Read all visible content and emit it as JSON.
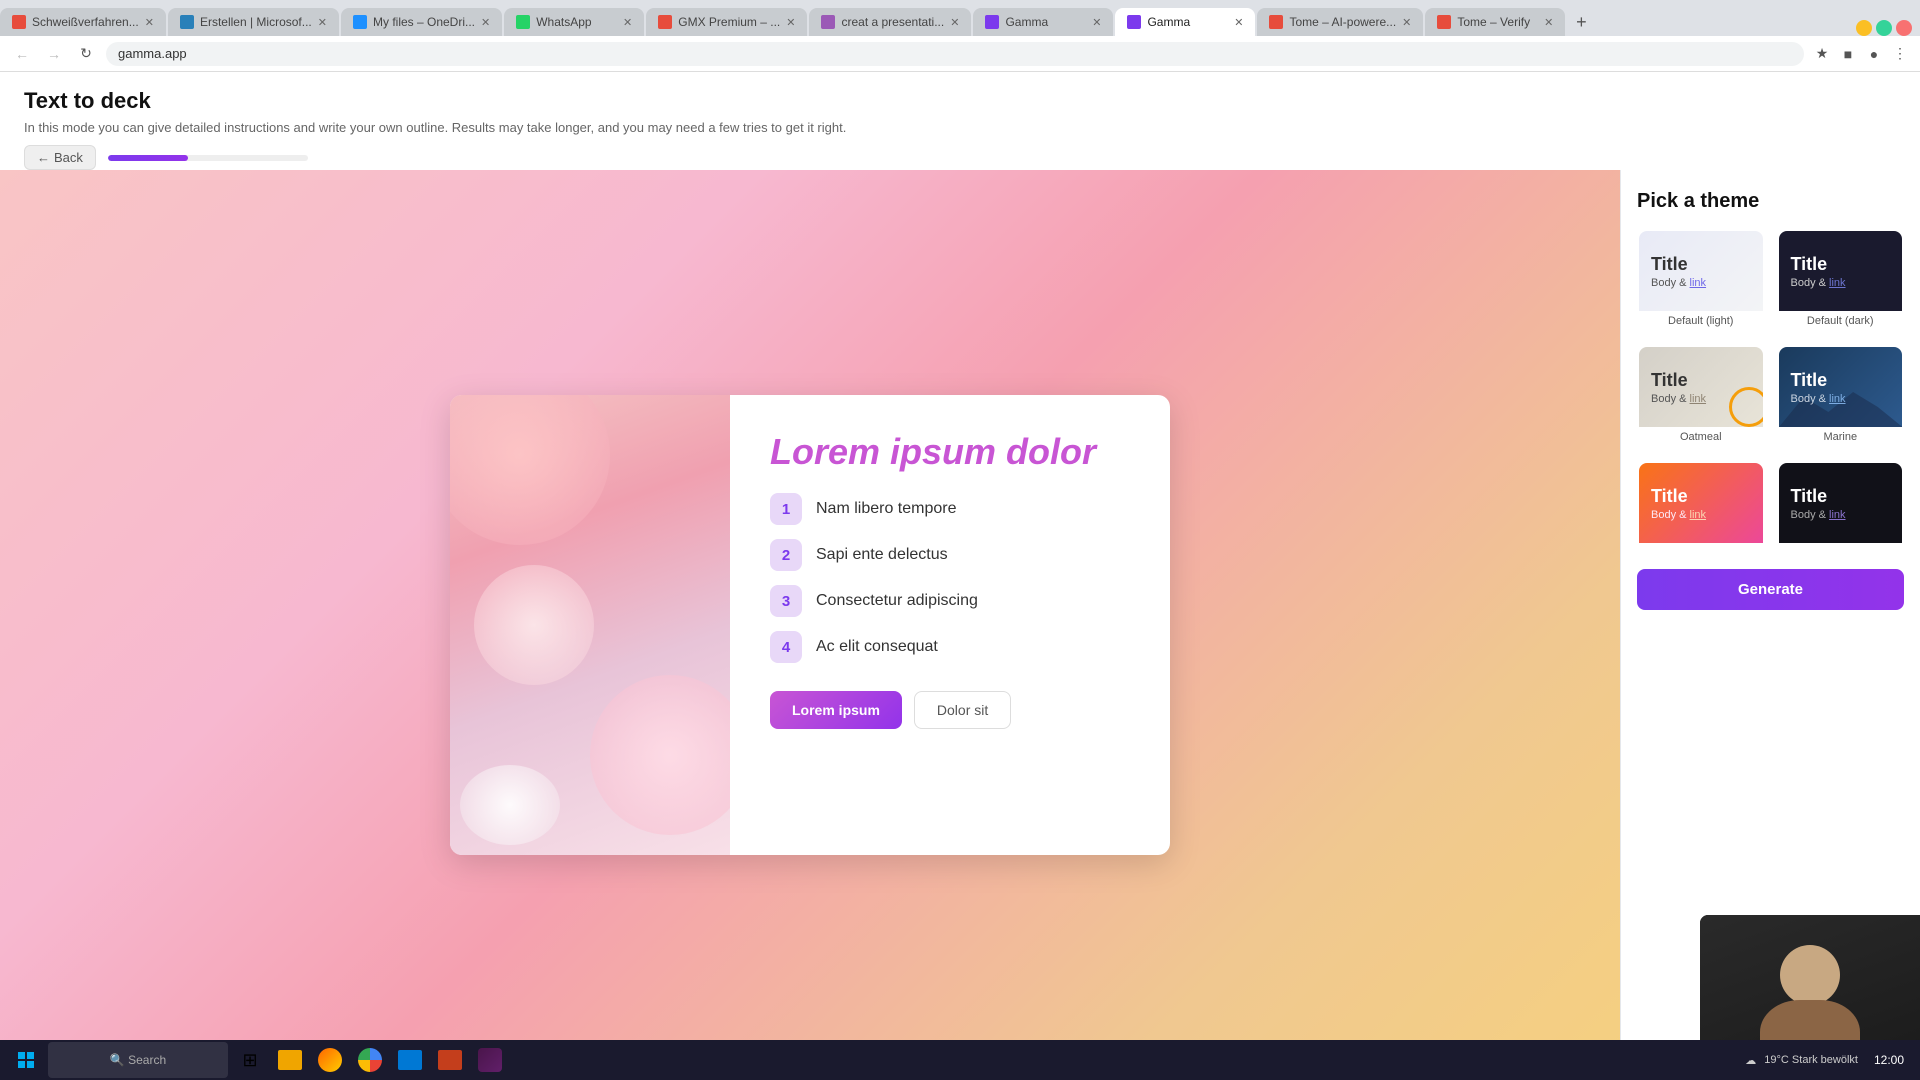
{
  "browser": {
    "tabs": [
      {
        "id": "tab1",
        "label": "Schweißverfahren...",
        "favicon_color": "#e74c3c",
        "active": false
      },
      {
        "id": "tab2",
        "label": "Erstellen | Microsof...",
        "favicon_color": "#2980b9",
        "active": false
      },
      {
        "id": "tab3",
        "label": "My files – OneDri...",
        "favicon_color": "#1e90ff",
        "active": false
      },
      {
        "id": "tab4",
        "label": "WhatsApp",
        "favicon_color": "#25d366",
        "active": false
      },
      {
        "id": "tab5",
        "label": "GMX Premium – ...",
        "favicon_color": "#e74c3c",
        "active": false
      },
      {
        "id": "tab6",
        "label": "creat a presentati...",
        "favicon_color": "#9b59b6",
        "active": false
      },
      {
        "id": "tab7",
        "label": "Gamma",
        "favicon_color": "#7c3aed",
        "active": false
      },
      {
        "id": "tab8",
        "label": "Gamma",
        "favicon_color": "#7c3aed",
        "active": true
      },
      {
        "id": "tab9",
        "label": "Tome – AI-powere...",
        "favicon_color": "#e74c3c",
        "active": false
      },
      {
        "id": "tab10",
        "label": "Tome – Verify",
        "favicon_color": "#e74c3c",
        "active": false
      }
    ],
    "address": "gamma.app"
  },
  "page": {
    "title": "Text to deck",
    "subtitle": "In this mode you can give detailed instructions and write your own outline. Results may take longer, and you may need a few tries to get it right.",
    "back_label": "Back",
    "progress_percent": 40
  },
  "slide": {
    "title": "Lorem ipsum dolor",
    "items": [
      {
        "number": "1",
        "text": "Nam libero tempore"
      },
      {
        "number": "2",
        "text": "Sapi ente delectus"
      },
      {
        "number": "3",
        "text": "Consectetur adipiscing"
      },
      {
        "number": "4",
        "text": "Ac elit consequat"
      }
    ],
    "btn_primary": "Lorem ipsum",
    "btn_secondary": "Dolor sit"
  },
  "theme_panel": {
    "title": "Pick a theme",
    "themes": [
      {
        "id": "default-light",
        "label": "Default (light)",
        "type": "light",
        "preview_title": "Title",
        "preview_body": "Body & ",
        "preview_link": "link"
      },
      {
        "id": "default-dark",
        "label": "Default (dark)",
        "type": "dark",
        "preview_title": "Title",
        "preview_body": "Body & ",
        "preview_link": "link"
      },
      {
        "id": "oatmeal",
        "label": "Oatmeal",
        "type": "oatmeal",
        "preview_title": "Title",
        "preview_body": "Body & ",
        "preview_link": "link"
      },
      {
        "id": "marine",
        "label": "Marine",
        "type": "marine",
        "preview_title": "Title",
        "preview_body": "Body & ",
        "preview_link": "link"
      },
      {
        "id": "vibrant",
        "label": "",
        "type": "vibrant",
        "preview_title": "Title",
        "preview_body": "Body & ",
        "preview_link": "link"
      },
      {
        "id": "dark2",
        "label": "",
        "type": "dark2",
        "preview_title": "Title",
        "preview_body": "Body & ",
        "preview_link": "link"
      }
    ],
    "generate_btn": "Generate"
  },
  "taskbar": {
    "weather": "19°C  Stark bewölkt"
  }
}
